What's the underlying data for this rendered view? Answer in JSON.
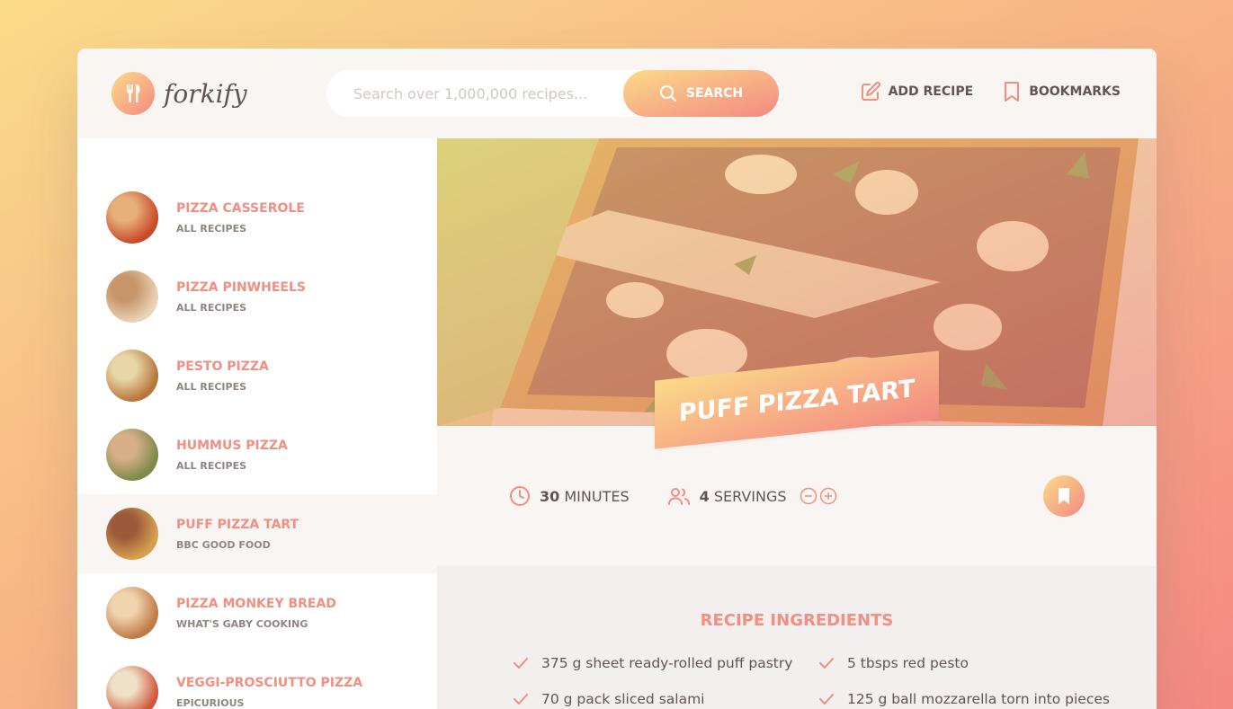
{
  "header": {
    "logo_text": "forkify",
    "search_placeholder": "Search over 1,000,000 recipes...",
    "search_label": "SEARCH",
    "add_recipe_label": "ADD RECIPE",
    "bookmarks_label": "BOOKMARKS"
  },
  "results": [
    {
      "title": "PIZZA CASSEROLE",
      "publisher": "ALL RECIPES",
      "colors": [
        "#c94a2a",
        "#e7b07a"
      ]
    },
    {
      "title": "PIZZA PINWHEELS",
      "publisher": "ALL RECIPES",
      "colors": [
        "#e9d2b6",
        "#c8946a"
      ]
    },
    {
      "title": "PESTO PIZZA",
      "publisher": "ALL RECIPES",
      "colors": [
        "#b8763a",
        "#e8d6a8"
      ]
    },
    {
      "title": "HUMMUS PIZZA",
      "publisher": "ALL RECIPES",
      "colors": [
        "#7e8a4a",
        "#d8b088"
      ]
    },
    {
      "title": "PUFF PIZZA TART",
      "publisher": "BBC GOOD FOOD",
      "colors": [
        "#d6a14f",
        "#9b5a3a"
      ]
    },
    {
      "title": "PIZZA MONKEY BREAD",
      "publisher": "WHAT'S GABY COOKING",
      "colors": [
        "#c07a46",
        "#f0d4b0"
      ]
    },
    {
      "title": "VEGGI-PROSCIUTTO PIZZA",
      "publisher": "EPICURIOUS",
      "colors": [
        "#d2563a",
        "#efe1c8"
      ]
    }
  ],
  "active_result_index": 4,
  "recipe": {
    "title": "PUFF PIZZA TART",
    "minutes_value": "30",
    "minutes_label": "MINUTES",
    "servings_value": "4",
    "servings_label": "SERVINGS",
    "ingredients_heading": "RECIPE INGREDIENTS",
    "ingredients": [
      "375 g sheet ready-rolled puff pastry",
      "5 tbsps red pesto",
      "70 g pack sliced salami",
      "125 g ball mozzarella torn into pieces"
    ]
  },
  "colors": {
    "accent": "#f38e82",
    "gradient_start": "#fbdb89",
    "gradient_end": "#f48982",
    "text": "#615551",
    "muted": "#918581",
    "panel": "#f9f5f3"
  }
}
